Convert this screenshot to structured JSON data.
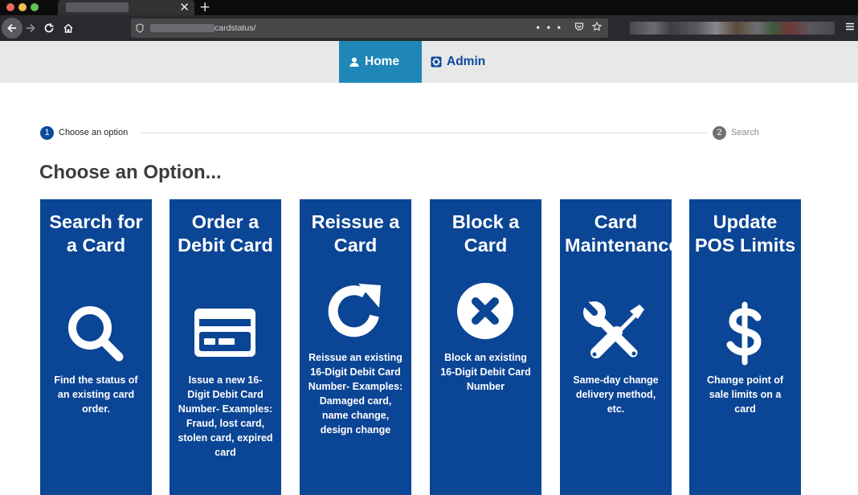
{
  "browser": {
    "address_text": "cardstatus/",
    "close_tab_glyph": "✕",
    "new_tab_glyph": "+",
    "icons": [
      "back-icon",
      "forward-icon",
      "reload-icon",
      "home-icon",
      "shield-icon",
      "more-icon",
      "pocket-icon",
      "bookmark-star-icon",
      "menu-icon"
    ]
  },
  "nav": {
    "home_label": "Home",
    "admin_label": "Admin"
  },
  "stepper": {
    "step1_number": "1",
    "step1_label": "Choose an option",
    "step2_number": "2",
    "step2_label": "Search"
  },
  "page": {
    "title": "Choose an Option..."
  },
  "cards": [
    {
      "title": "Search for a Card",
      "icon": "search-icon",
      "description": "Find the status of an existing card order."
    },
    {
      "title": "Order a Debit Card",
      "icon": "credit-card-icon",
      "description": "Issue a new 16-Digit Debit Card Number- Examples: Fraud, lost card, stolen card, expired card"
    },
    {
      "title": "Reissue a Card",
      "icon": "redo-icon",
      "description": "Reissue an existing 16-Digit Debit Card Number- Examples: Damaged card, name change, design change"
    },
    {
      "title": "Block a Card",
      "icon": "block-x-icon",
      "description": "Block an existing 16-Digit Debit Card Number"
    },
    {
      "title": "Card Maintenance",
      "icon": "tools-icon",
      "description": "Same-day change delivery method, etc."
    },
    {
      "title": "Update POS Limits",
      "icon": "dollar-icon",
      "description": "Change point of sale limits on a card"
    }
  ],
  "colors": {
    "card_blue": "#0b4595",
    "nav_active": "#1f87b8",
    "nav_text": "#0a4a9a",
    "step_active": "#0a4a9a"
  }
}
